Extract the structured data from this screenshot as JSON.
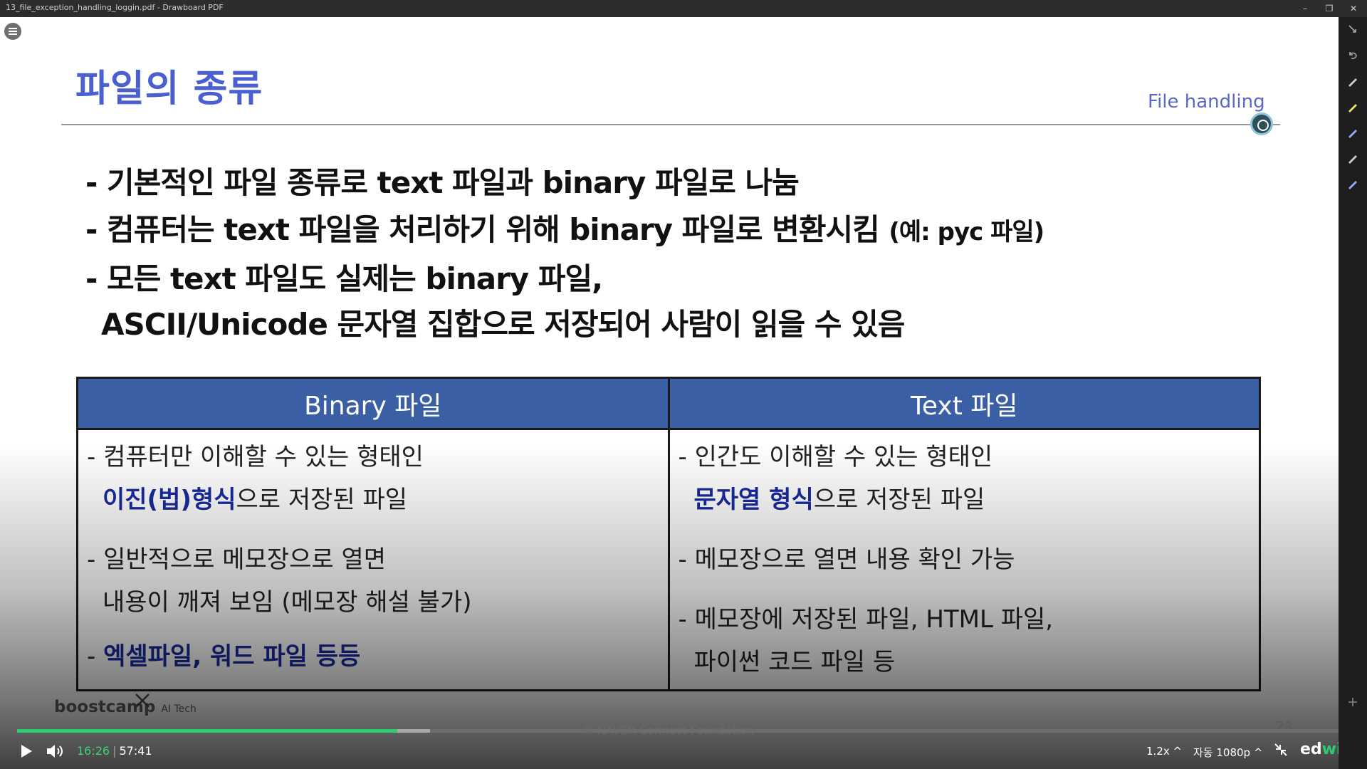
{
  "window": {
    "title": "13_file_exception_handling_loggin.pdf - Drawboard PDF"
  },
  "slide": {
    "title": "파일의 종류",
    "subtitle": "File handling",
    "bullets": [
      "- 기본적인 파일 종류로 text 파일과 binary 파일로 나눔",
      "- 컴퓨터는 text 파일을 처리하기 위해 binary 파일로 변환시킴 ",
      "- 모든 text 파일도 실제는 binary 파일,",
      "ASCII/Unicode 문자열 집합으로 저장되어 사람이 읽을 수 있음"
    ],
    "bullet2_note": "(예: pyc 파일)",
    "table": {
      "headers": [
        "Binary 파일",
        "Text 파일"
      ],
      "binary": {
        "l1": "- 컴퓨터만 이해할 수 있는 형태인",
        "l2_hl": "이진(법)형식",
        "l2_rest": "으로 저장된 파일",
        "l3": "- 일반적으로 메모장으로 열면",
        "l4": "내용이 깨져 보임 (메모장 해설 불가)",
        "l5_prefix": "- ",
        "l5_hl": "엑셀파일, 워드 파일 등등"
      },
      "text": {
        "l1": "- 인간도 이해할 수 있는 형태인",
        "l2_hl": "문자열 형식",
        "l2_rest": "으로 저장된 파일",
        "l3": "- 메모장으로 열면 내용 확인 가능",
        "l4": "- 메모장에 저장된 파일, HTML 파일,",
        "l5": "파이썬 코드 파일 등"
      }
    },
    "brand": "boostcamp",
    "brand_sub": "AI Tech",
    "copyright": "© NAVER Connect Foundation",
    "page_number": "23"
  },
  "player": {
    "current_time": "16:26",
    "separator": "|",
    "total_time": "57:41",
    "progress_fraction": 0.285,
    "speed": "1.2x ^",
    "quality": "자동 1080p ^",
    "logo_ed": "ed",
    "logo_with": "with"
  },
  "colors": {
    "title": "#4a5fd0",
    "table_header": "#3a5fa5",
    "highlight": "#1a2a9e",
    "progress": "#2ecc71"
  },
  "icons": {
    "menu": "menu-icon",
    "close": "close-icon",
    "play": "play-icon",
    "volume": "volume-icon",
    "fullscreen": "exit-fullscreen-icon",
    "tools": [
      "pointer-icon",
      "undo-icon",
      "pen-icon",
      "highlighter-icon",
      "pen-icon",
      "pen-icon",
      "pen-icon",
      "add-icon"
    ]
  }
}
